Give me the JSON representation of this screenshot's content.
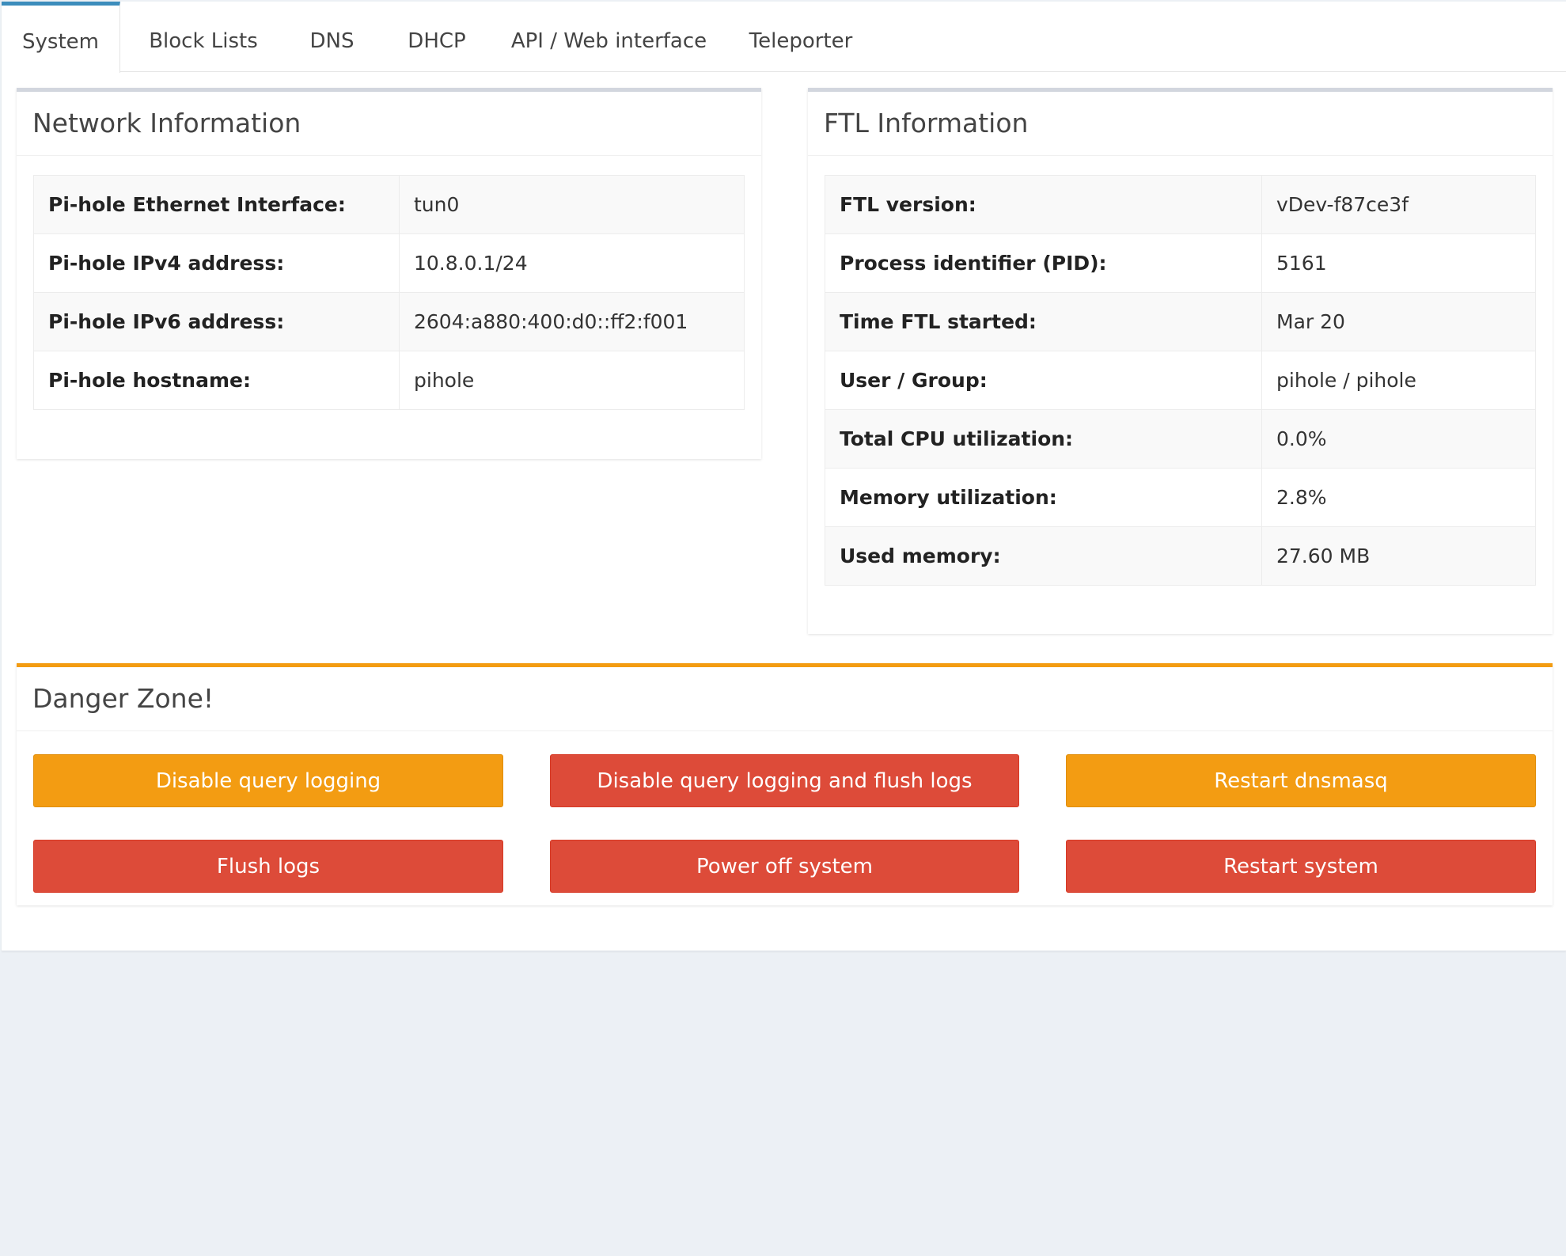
{
  "tabs": [
    "System",
    "Block Lists",
    "DNS",
    "DHCP",
    "API / Web interface",
    "Teleporter"
  ],
  "network": {
    "title": "Network Information",
    "rows": [
      {
        "label": "Pi-hole Ethernet Interface:",
        "value": "tun0"
      },
      {
        "label": "Pi-hole IPv4 address:",
        "value": "10.8.0.1/24"
      },
      {
        "label": "Pi-hole IPv6 address:",
        "value": "2604:a880:400:d0::ff2:f001"
      },
      {
        "label": "Pi-hole hostname:",
        "value": "pihole"
      }
    ]
  },
  "ftl": {
    "title": "FTL Information",
    "rows": [
      {
        "label": "FTL version:",
        "value": "vDev-f87ce3f"
      },
      {
        "label": "Process identifier (PID):",
        "value": "5161"
      },
      {
        "label": "Time FTL started:",
        "value": "Mar 20"
      },
      {
        "label": "User / Group:",
        "value": "pihole / pihole"
      },
      {
        "label": "Total CPU utilization:",
        "value": "0.0%"
      },
      {
        "label": "Memory utilization:",
        "value": "2.8%"
      },
      {
        "label": "Used memory:",
        "value": "27.60 MB"
      }
    ]
  },
  "danger": {
    "title": "Danger Zone!",
    "buttons": [
      "Disable query logging",
      "Disable query logging and flush logs",
      "Restart dnsmasq",
      "Flush logs",
      "Power off system",
      "Restart system"
    ]
  },
  "colors": {
    "accent": "#3c8dbc",
    "warning": "#f39c12",
    "danger": "#dd4b39",
    "background": "#ecf0f5"
  }
}
